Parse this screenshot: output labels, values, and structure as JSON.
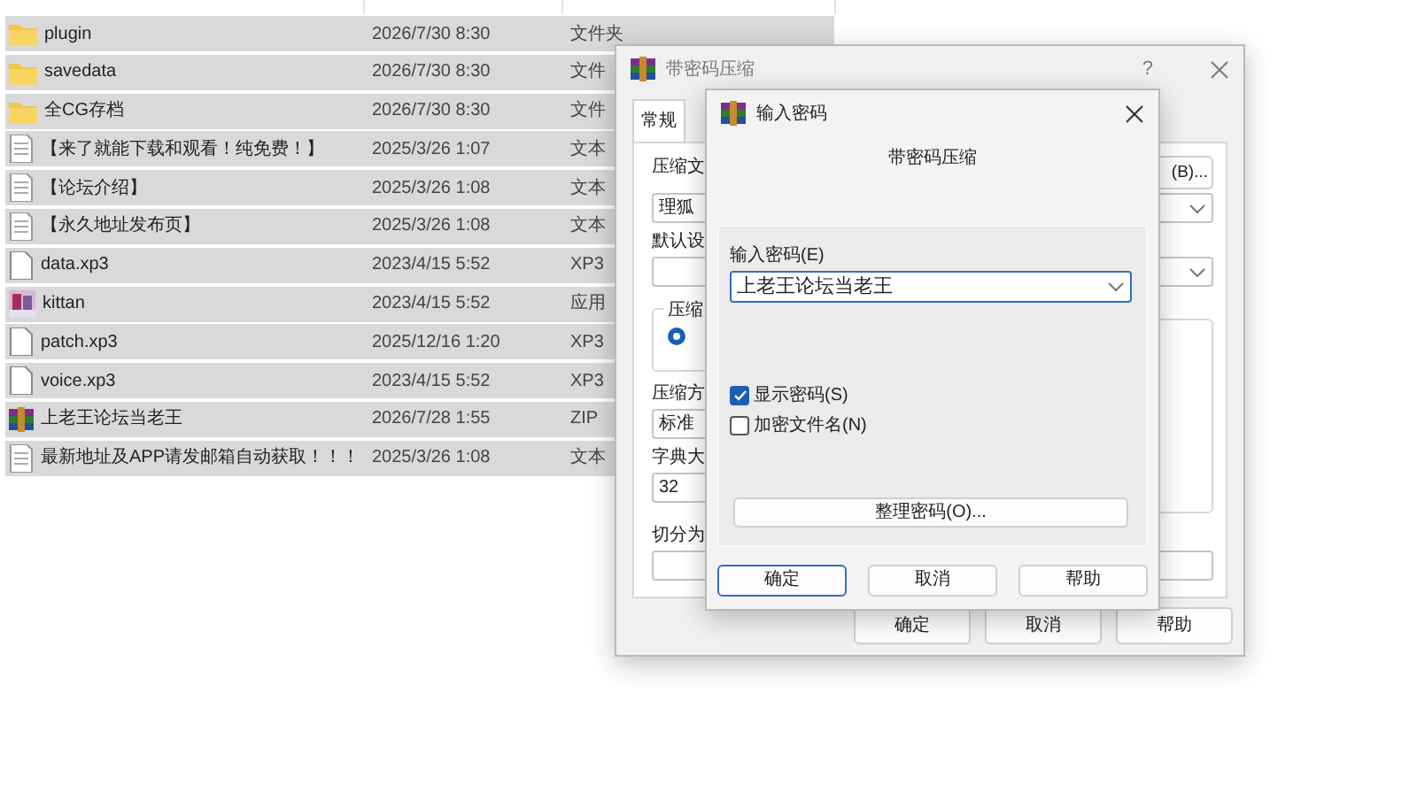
{
  "file_list": {
    "rows": [
      {
        "kind": "folder",
        "name": "plugin",
        "date": "2026/7/30 8:30",
        "type": "文件夹"
      },
      {
        "kind": "folder",
        "name": "savedata",
        "date": "2026/7/30 8:30",
        "type": "文件"
      },
      {
        "kind": "folder",
        "name": "全CG存档",
        "date": "2026/7/30 8:30",
        "type": "文件"
      },
      {
        "kind": "text",
        "name": "【来了就能下载和观看！纯免费！】",
        "date": "2025/3/26 1:07",
        "type": "文本"
      },
      {
        "kind": "text",
        "name": "【论坛介绍】",
        "date": "2025/3/26 1:08",
        "type": "文本"
      },
      {
        "kind": "text",
        "name": "【永久地址发布页】",
        "date": "2025/3/26 1:08",
        "type": "文本"
      },
      {
        "kind": "file",
        "name": "data.xp3",
        "date": "2023/4/15 5:52",
        "type": "XP3"
      },
      {
        "kind": "app",
        "name": "kittan",
        "date": "2023/4/15 5:52",
        "type": "应用"
      },
      {
        "kind": "file",
        "name": "patch.xp3",
        "date": "2025/12/16 1:20",
        "type": "XP3"
      },
      {
        "kind": "file",
        "name": "voice.xp3",
        "date": "2023/4/15 5:52",
        "type": "XP3"
      },
      {
        "kind": "archive",
        "name": "上老王论坛当老王",
        "date": "2026/7/28 1:55",
        "type": "ZIP"
      },
      {
        "kind": "text",
        "name": "最新地址及APP请发邮箱自动获取！！！",
        "date": "2025/3/26 1:08",
        "type": "文本"
      }
    ]
  },
  "archive_dialog": {
    "title": "带密码压缩",
    "help_glyph": "?",
    "tabs": [
      {
        "label": "常规",
        "selected": true
      }
    ],
    "archive_name_label": "压缩文",
    "browse_button": "(B)...",
    "archive_name": "理狐",
    "profile_label": "默认设",
    "format_group_label": "压缩",
    "format_radio": {
      "checked": true
    },
    "method_label": "压缩方",
    "method": "标准",
    "dictionary_label": "字典大",
    "dictionary": "32",
    "split_label": "切分为",
    "buttons": [
      "确定",
      "取消",
      "帮助"
    ]
  },
  "password_dialog": {
    "title": "输入密码",
    "heading": "带密码压缩",
    "password_label": "输入密码(E)",
    "password": "上老王论坛当老王",
    "options": [
      {
        "label": "显示密码(S)",
        "checked": true
      },
      {
        "label": "加密文件名(N)",
        "checked": false
      }
    ],
    "organize_button": "整理密码(O)...",
    "buttons": [
      {
        "label": "确定",
        "default": true
      },
      {
        "label": "取消",
        "default": false
      },
      {
        "label": "帮助",
        "default": false
      }
    ]
  }
}
